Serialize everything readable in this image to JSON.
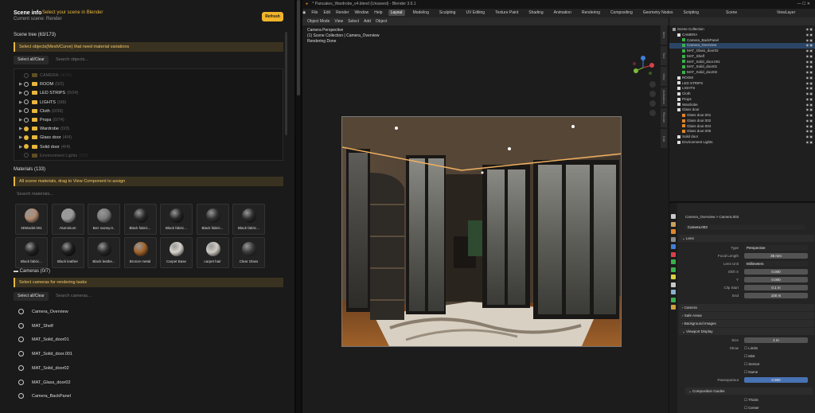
{
  "left_panel": {
    "title": "Scene info",
    "hint": "Select your scene in Blender",
    "subtitle": "Current scene: Render",
    "refresh_label": "Refresh",
    "scene_tree": {
      "heading": "Scene tree (63/173)",
      "banner": "Select objects(Mesh/Curve) that need material variations",
      "select_label": "Select all/Clear",
      "search_placeholder": "Search objects...",
      "items": [
        {
          "name": "CAMERA",
          "count": "(4/24)",
          "checked": false,
          "dim": true,
          "arrow": ""
        },
        {
          "name": "ROOM",
          "count": "(0/2)",
          "checked": false,
          "dim": false,
          "arrow": "▶"
        },
        {
          "name": "LED STRIPS",
          "count": "(0/24)",
          "checked": false,
          "dim": false,
          "arrow": "▶"
        },
        {
          "name": "LIGHTS",
          "count": "(0/8)",
          "checked": false,
          "dim": false,
          "arrow": "▶"
        },
        {
          "name": "Cloth",
          "count": "(0/36)",
          "checked": false,
          "dim": false,
          "arrow": "▶"
        },
        {
          "name": "Props",
          "count": "(0/74)",
          "checked": false,
          "dim": false,
          "arrow": "▶"
        },
        {
          "name": "Wardrobe",
          "count": "(0/3)",
          "checked": true,
          "dim": false,
          "arrow": "▶"
        },
        {
          "name": "Glass door",
          "count": "(4/4)",
          "checked": true,
          "dim": false,
          "arrow": "▶"
        },
        {
          "name": "Solid door",
          "count": "(4/4)",
          "checked": true,
          "dim": false,
          "arrow": "▶"
        },
        {
          "name": "Environment Lights",
          "count": "(0/2)",
          "checked": false,
          "dim": true,
          "arrow": ""
        }
      ]
    },
    "materials": {
      "heading": "Materials (133)",
      "banner": "All scene materials, drag to View Component to assign",
      "search_placeholder": "Search materials...",
      "items": [
        {
          "label": "3DModel.001",
          "color": "#b08a70"
        },
        {
          "label": "Aluminium",
          "color": "#9a9a9a"
        },
        {
          "label": "Bez nazwy.0..",
          "color": "#7a7a7a"
        },
        {
          "label": "Black fabric...",
          "color": "#2a2a2a"
        },
        {
          "label": "Black fabric...",
          "color": "#262626"
        },
        {
          "label": "Black fabric...",
          "color": "#303030"
        },
        {
          "label": "Black fabric...",
          "color": "#2c2c2c"
        },
        {
          "label": "Black fabric...",
          "color": "#222222"
        },
        {
          "label": "Black leather",
          "color": "#1e1e1e"
        },
        {
          "label": "Black leathe...",
          "color": "#282828"
        },
        {
          "label": "Bronze metal",
          "color": "#a0632a"
        },
        {
          "label": "Carpet Base",
          "color": "#d8d4cc"
        },
        {
          "label": "carpet hair",
          "color": "#cfcac2"
        },
        {
          "label": "Clear Glass",
          "color": "#3a3a3a"
        }
      ]
    },
    "cameras": {
      "heading": "Cameras (0/7)",
      "banner": "Select cameras for rendering tasks",
      "select_label": "Select all/Clear",
      "search_placeholder": "Search cameras...",
      "items": [
        "Camera_Overview",
        "MAT_Shelf",
        "MAT_Solid_door01",
        "MAT_Solid_door.001",
        "MAT_Solid_door02",
        "MAT_Glass_door02",
        "Camera_BackPanel"
      ]
    }
  },
  "blender": {
    "window_title": "* Pancakes_Wardrobe_v4.blend (Unsaved) - Blender 3.6.1",
    "menu": [
      "File",
      "Edit",
      "Render",
      "Window",
      "Help"
    ],
    "workspaces": [
      "Layout",
      "Modeling",
      "Sculpting",
      "UV Editing",
      "Texture Paint",
      "Shading",
      "Animation",
      "Rendering",
      "Compositing",
      "Geometry Nodes",
      "Scripting"
    ],
    "active_workspace": "Layout",
    "scene_label": "Scene",
    "view_layer_label": "ViewLayer",
    "header3d": [
      "Object Mode",
      "View",
      "Select",
      "Add",
      "Object"
    ],
    "viewport_info": [
      "Camera Perspective",
      "(1) Scene Collection | Camera_Overview",
      "Rendering Done"
    ],
    "outliner": [
      {
        "label": "Scene Collection",
        "indent": 0,
        "sel": false,
        "icon": "#999"
      },
      {
        "label": "CAMERA",
        "indent": 1,
        "sel": false,
        "icon": "#ddd"
      },
      {
        "label": "Camera_BackPanel",
        "indent": 2,
        "sel": false,
        "icon": "#3ab04a"
      },
      {
        "label": "Camera_Overview",
        "indent": 2,
        "sel": true,
        "icon": "#3ab04a"
      },
      {
        "label": "MAT_Glass_door02",
        "indent": 2,
        "sel": false,
        "icon": "#3ab04a"
      },
      {
        "label": "MAT_Shelf",
        "indent": 2,
        "sel": false,
        "icon": "#3ab04a"
      },
      {
        "label": "MAT_Solid_door.001",
        "indent": 2,
        "sel": false,
        "icon": "#3ab04a"
      },
      {
        "label": "MAT_Solid_door01",
        "indent": 2,
        "sel": false,
        "icon": "#3ab04a"
      },
      {
        "label": "MAT_Solid_door02",
        "indent": 2,
        "sel": false,
        "icon": "#3ab04a"
      },
      {
        "label": "ROOM",
        "indent": 1,
        "sel": false,
        "icon": "#ddd"
      },
      {
        "label": "LED STRIPS",
        "indent": 1,
        "sel": false,
        "icon": "#ddd"
      },
      {
        "label": "LIGHTS",
        "indent": 1,
        "sel": false,
        "icon": "#ddd"
      },
      {
        "label": "Cloth",
        "indent": 1,
        "sel": false,
        "icon": "#ddd"
      },
      {
        "label": "Props",
        "indent": 1,
        "sel": false,
        "icon": "#ddd"
      },
      {
        "label": "Wardrobe",
        "indent": 1,
        "sel": false,
        "icon": "#ddd"
      },
      {
        "label": "Glass door",
        "indent": 1,
        "sel": false,
        "icon": "#ddd"
      },
      {
        "label": "Glass door.001",
        "indent": 2,
        "sel": false,
        "icon": "#e0862a"
      },
      {
        "label": "Glass door.002",
        "indent": 2,
        "sel": false,
        "icon": "#e0862a"
      },
      {
        "label": "Glass door.004",
        "indent": 2,
        "sel": false,
        "icon": "#e0862a"
      },
      {
        "label": "Glass door.005",
        "indent": 2,
        "sel": false,
        "icon": "#e0862a"
      },
      {
        "label": "Solid door",
        "indent": 1,
        "sel": false,
        "icon": "#ddd"
      },
      {
        "label": "Environment Lights",
        "indent": 1,
        "sel": false,
        "icon": "#ddd"
      }
    ],
    "props": {
      "breadcrumb": "Camera_Overview  >  Camera.003",
      "datablock": "Camera.003",
      "lens_section": "Lens",
      "rows": [
        {
          "label": "Type",
          "value": "Perspective",
          "kind": "drop"
        },
        {
          "label": "Focal Length",
          "value": "35 mm",
          "kind": "num"
        },
        {
          "label": "Lens Unit",
          "value": "Millimeters",
          "kind": "drop"
        },
        {
          "label": "Shift X",
          "value": "0.000",
          "kind": "num"
        },
        {
          "label": "Y",
          "value": "0.000",
          "kind": "num"
        },
        {
          "label": "Clip Start",
          "value": "0.1 m",
          "kind": "num"
        },
        {
          "label": "End",
          "value": "100 m",
          "kind": "num"
        }
      ],
      "sections": [
        "Camera",
        "Safe Areas",
        "Background Images",
        "Viewport Display"
      ],
      "vd_rows": [
        {
          "label": "Size",
          "value": "1 m",
          "kind": "num"
        },
        {
          "label": "Show",
          "value": "Limits",
          "kind": "check"
        },
        {
          "label": "",
          "value": "Mist",
          "kind": "check"
        },
        {
          "label": "",
          "value": "Sensor",
          "kind": "check"
        },
        {
          "label": "",
          "value": "Name",
          "kind": "check"
        },
        {
          "label": "Passepartout",
          "value": "0.950",
          "kind": "blue"
        }
      ],
      "composition": "Composition Guides",
      "comp_rows": [
        "Thirds",
        "Center"
      ]
    }
  }
}
